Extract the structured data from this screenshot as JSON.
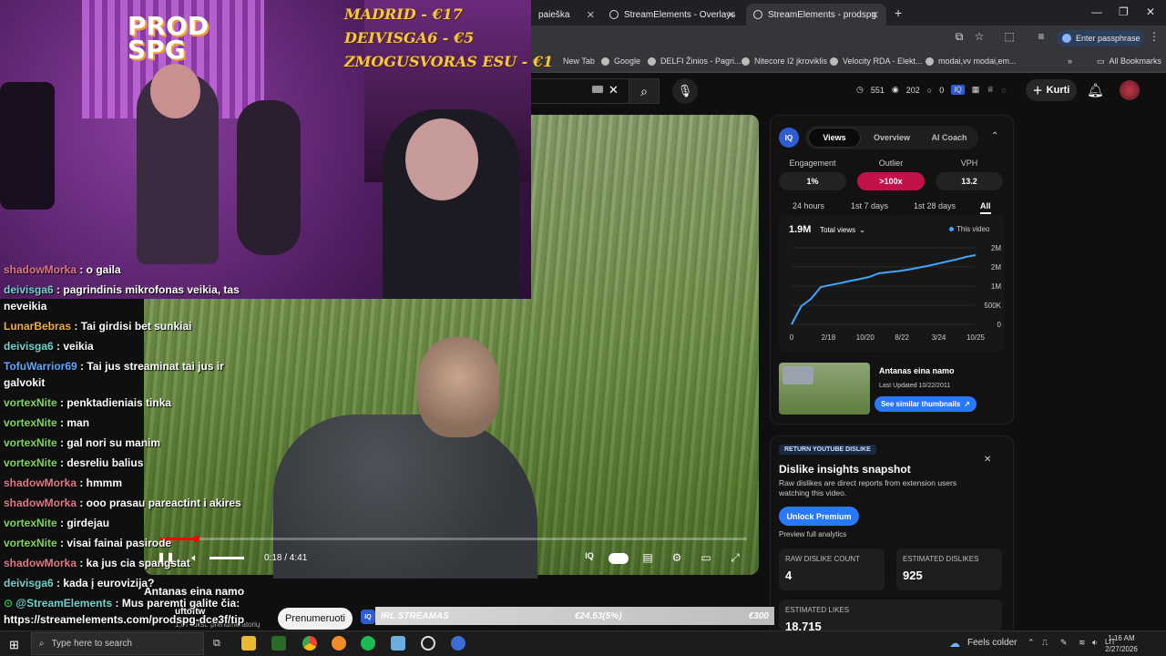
{
  "browser": {
    "tabs": [
      {
        "label": "paieška",
        "close": "✕"
      },
      {
        "label": "StreamElements - Overlays",
        "close": "✕"
      },
      {
        "label": "StreamElements - prodspg",
        "close": "✕"
      }
    ],
    "new_tab": "+",
    "window_controls": [
      "—",
      "❐",
      "✕"
    ],
    "passphrase_label": "Enter passphrase",
    "bookmarks": [
      "New Tab",
      "Google",
      "DELFI Žinios - Pagri...",
      "Nitecore I2 įkroviklis",
      "Velocity RDA - Elekt...",
      "modai,vv modai,em..."
    ],
    "all_bookmarks": "All Bookmarks",
    "bookmarks_more": "»"
  },
  "youtube": {
    "stats": {
      "a": "551",
      "b": "202",
      "c": "0"
    },
    "create_label": "Kurti",
    "video": {
      "time": "0:18 / 4:41",
      "progress_fraction": 0.064,
      "title": "Antanas eina namo",
      "channel": "uftoftw",
      "subs": "1,07 tūkst. prenumeratorių",
      "subscribe_label": "Prenumeruoti"
    }
  },
  "vidiq": {
    "tabs": [
      "Views",
      "Overview",
      "AI Coach"
    ],
    "metrics": [
      {
        "label": "Engagement",
        "value": "1%"
      },
      {
        "label": "Outlier",
        "value": ">100x"
      },
      {
        "label": "VPH",
        "value": "13.2"
      }
    ],
    "ranges": [
      "24 hours",
      "1st 7 days",
      "1st 28 days",
      "All"
    ],
    "views_total": "1.9M",
    "views_select": "Total views",
    "legend": "This video",
    "thumb_title": "Antanas eina namo",
    "thumb_updated": "Last Updated 10/22/2011",
    "similar_btn": "See similar thumbnails",
    "accent": "#3ea6ff"
  },
  "chart_data": {
    "type": "line",
    "x_ticks": [
      "0",
      "2/18",
      "10/20",
      "8/22",
      "3/24",
      "10/25"
    ],
    "y_ticks": [
      "0",
      "500K",
      "1M",
      "2M",
      "2M"
    ],
    "series": [
      {
        "values": [
          0,
          0.5,
          0.7,
          1.02,
          1.08,
          1.13,
          1.19,
          1.24,
          1.3,
          1.4,
          1.43,
          1.46,
          1.5,
          1.55,
          1.6,
          1.66,
          1.72,
          1.78,
          1.85,
          1.9
        ]
      }
    ],
    "ylim": [
      0,
      2.1
    ],
    "legend_position": "top-right"
  },
  "dislike": {
    "badge": "RETURN YOUTUBE DISLIKE",
    "close": "✕",
    "title": "Dislike insights snapshot",
    "desc": "Raw dislikes are direct reports from extension users watching this video.",
    "unlock": "Unlock Premium",
    "preview": "Preview full analytics",
    "raw_label": "RAW DISLIKE COUNT",
    "raw_value": "4",
    "est_label": "ESTIMATED DISLIKES",
    "est_value": "925",
    "likes_label": "ESTIMATED LIKES",
    "likes_value": "18,715"
  },
  "overlay": {
    "logo_line1": "PROD",
    "logo_line2": "SPG",
    "donors": [
      "MADRID - €17",
      "DEIVISGA6 - €5",
      "ZMOGUSVORAS ESU - €1"
    ],
    "ticker_left": "IRL STREAMAS",
    "ticker_mid": "€24.53(5%)",
    "ticker_right": "€300"
  },
  "chat": [
    {
      "user": "shadowMorka",
      "color": "u-red",
      "msg": " : o gaila"
    },
    {
      "user": "deivisga6",
      "color": "u-teal",
      "msg": " : pagrindinis mikrofonas veikia, tas",
      "cont": "neveikia"
    },
    {
      "user": "LunarBebras",
      "color": "u-gold",
      "msg": " : Tai girdisi bet sunkiai"
    },
    {
      "user": "deivisga6",
      "color": "u-teal",
      "msg": " : veikia"
    },
    {
      "user": "TofuWarrior69",
      "color": "u-blue",
      "msg": " : Tai jus streaminat tai jus ir",
      "cont": "galvokit"
    },
    {
      "user": "vortexNite",
      "color": "u-green",
      "msg": " : penktadieniais tinka"
    },
    {
      "user": "vortexNite",
      "color": "u-green",
      "msg": " : man"
    },
    {
      "user": "vortexNite",
      "color": "u-green",
      "msg": " : gal nori su manim"
    },
    {
      "user": "vortexNite",
      "color": "u-green",
      "msg": " : desreliu balius"
    },
    {
      "user": "shadowMorka",
      "color": "u-red",
      "msg": " : hmmm"
    },
    {
      "user": "shadowMorka",
      "color": "u-red",
      "msg": " : ooo prasau pareactint i akires"
    },
    {
      "user": "vortexNite",
      "color": "u-green",
      "msg": " : girdejau"
    },
    {
      "user": "vortexNite",
      "color": "u-green",
      "msg": " : visai fainai pasirode"
    },
    {
      "user": "shadowMorka",
      "color": "u-red",
      "msg": " : ka jus cia spangstat"
    },
    {
      "user": "deivisga6",
      "color": "u-teal",
      "msg": " : kada į eurovizija?"
    }
  ],
  "chat_bot": {
    "user": "@StreamElements",
    "msg": " : Mus paremti galite čia:",
    "url": "https://streamelements.com/prodspg-dce3f/tip"
  },
  "taskbar": {
    "search_placeholder": "Type here to search",
    "weather": "Feels colder",
    "lang": "LIT",
    "time": "1:16 AM",
    "date": "2/27/2026"
  }
}
